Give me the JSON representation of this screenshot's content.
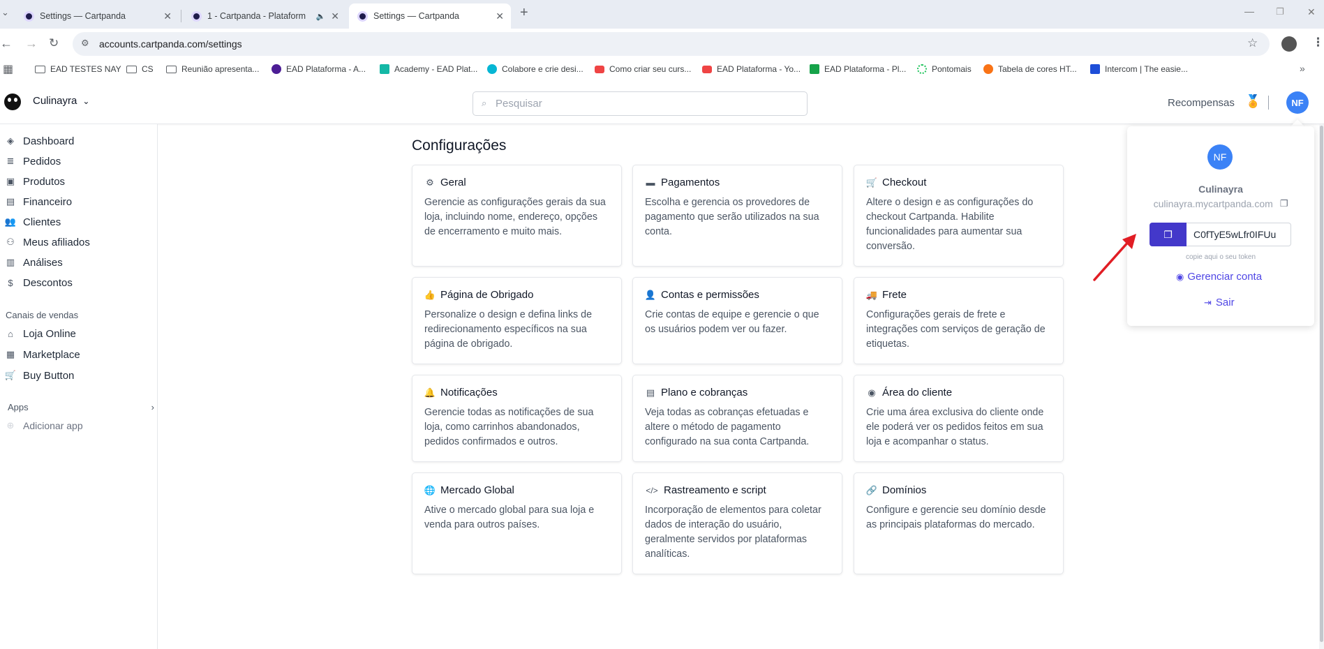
{
  "browser": {
    "tabs": [
      {
        "title": "Settings — Cartpanda",
        "active": false
      },
      {
        "title": "1 - Cartpanda - Plataform",
        "active": false
      },
      {
        "title": "Settings — Cartpanda",
        "active": true
      }
    ],
    "url": "accounts.cartpanda.com/settings",
    "bookmarks": [
      {
        "label": "EAD TESTES NAY",
        "icon": "folder-icon"
      },
      {
        "label": "CS",
        "icon": "folder-icon"
      },
      {
        "label": "Reunião apresenta...",
        "icon": "folder-icon"
      },
      {
        "label": "EAD Plataforma - A...",
        "icon": "site-icon"
      },
      {
        "label": "Academy - EAD Plat...",
        "icon": "site-icon"
      },
      {
        "label": "Colabore e crie desi...",
        "icon": "canva-icon"
      },
      {
        "label": "Como criar seu curs...",
        "icon": "youtube-icon"
      },
      {
        "label": "EAD Plataforma - Yo...",
        "icon": "youtube-icon"
      },
      {
        "label": "EAD Plataforma - Pl...",
        "icon": "sheets-icon"
      },
      {
        "label": "Pontomais",
        "icon": "site-icon"
      },
      {
        "label": "Tabela de cores HT...",
        "icon": "site-icon"
      },
      {
        "label": "Intercom | The easie...",
        "icon": "site-icon"
      }
    ]
  },
  "header": {
    "store_name": "Culinayra",
    "search_placeholder": "Pesquisar",
    "rewards_label": "Recompensas",
    "avatar_initials": "NF"
  },
  "sidebar": {
    "items": [
      {
        "label": "Dashboard",
        "icon": "cube-icon"
      },
      {
        "label": "Pedidos",
        "icon": "database-icon"
      },
      {
        "label": "Produtos",
        "icon": "box-icon"
      },
      {
        "label": "Financeiro",
        "icon": "finance-icon"
      },
      {
        "label": "Clientes",
        "icon": "users-icon"
      },
      {
        "label": "Meus afiliados",
        "icon": "affiliates-icon"
      },
      {
        "label": "Análises",
        "icon": "analytics-icon"
      },
      {
        "label": "Descontos",
        "icon": "discount-icon"
      }
    ],
    "sales_channels_title": "Canais de vendas",
    "channels": [
      {
        "label": "Loja Online",
        "icon": "home-icon"
      },
      {
        "label": "Marketplace",
        "icon": "store-icon"
      },
      {
        "label": "Buy Button",
        "icon": "cart-icon"
      }
    ],
    "apps_title": "Apps",
    "add_app_label": "Adicionar app"
  },
  "main": {
    "title": "Configurações",
    "cards": [
      {
        "title": "Geral",
        "icon": "gear-icon",
        "desc": "Gerencie as configurações gerais da sua loja, incluindo nome, endereço, opções de encerramento e muito mais."
      },
      {
        "title": "Pagamentos",
        "icon": "credit-card-icon",
        "desc": "Escolha e gerencia os provedores de pagamento que serão utilizados na sua conta."
      },
      {
        "title": "Checkout",
        "icon": "cart-icon",
        "desc": "Altere o design e as configurações do checkout Cartpanda. Habilite funcionalidades para aumentar sua conversão."
      },
      {
        "title": "Página de Obrigado",
        "icon": "thumbs-up-icon",
        "desc": "Personalize o design e defina links de redirecionamento específicos na sua página de obrigado."
      },
      {
        "title": "Contas e permissões",
        "icon": "user-icon",
        "desc": "Crie contas de equipe e gerencie o que os usuários podem ver ou fazer."
      },
      {
        "title": "Frete",
        "icon": "truck-icon",
        "desc": "Configurações gerais de frete e integrações com serviços de geração de etiquetas."
      },
      {
        "title": "Notificações",
        "icon": "bell-icon",
        "desc": "Gerencie todas as notificações de sua loja, como carrinhos abandonados, pedidos confirmados e outros."
      },
      {
        "title": "Plano e cobranças",
        "icon": "invoice-icon",
        "desc": "Veja todas as cobranças efetuadas e altere o método de pagamento configurado na sua conta Cartpanda."
      },
      {
        "title": "Área do cliente",
        "icon": "user-circle-icon",
        "desc": "Crie uma área exclusiva do cliente onde ele poderá ver os pedidos feitos em sua loja e acompanhar o status."
      },
      {
        "title": "Mercado Global",
        "icon": "globe-icon",
        "desc": "Ative o mercado global para sua loja e venda para outros países."
      },
      {
        "title": "Rastreamento e script",
        "icon": "code-icon",
        "desc": "Incorporação de elementos para coletar dados de interação do usuário, geralmente servidos por plataformas analíticas."
      },
      {
        "title": "Domínios",
        "icon": "link-icon",
        "desc": "Configure e gerencie seu domínio desde as principais plataformas do mercado."
      }
    ]
  },
  "account_popover": {
    "initials": "NF",
    "store_name": "Culinayra",
    "domain": "culinayra.mycartpanda.com",
    "token": "C0fTyE5wLfr0IFUu",
    "token_hint": "copie aqui o seu token",
    "manage_label": "Gerenciar conta",
    "logout_label": "Sair"
  },
  "colors": {
    "accent": "#4338ca",
    "avatar": "#3b82f6",
    "link": "#4f46e5",
    "annotation_arrow": "#e11d24"
  }
}
